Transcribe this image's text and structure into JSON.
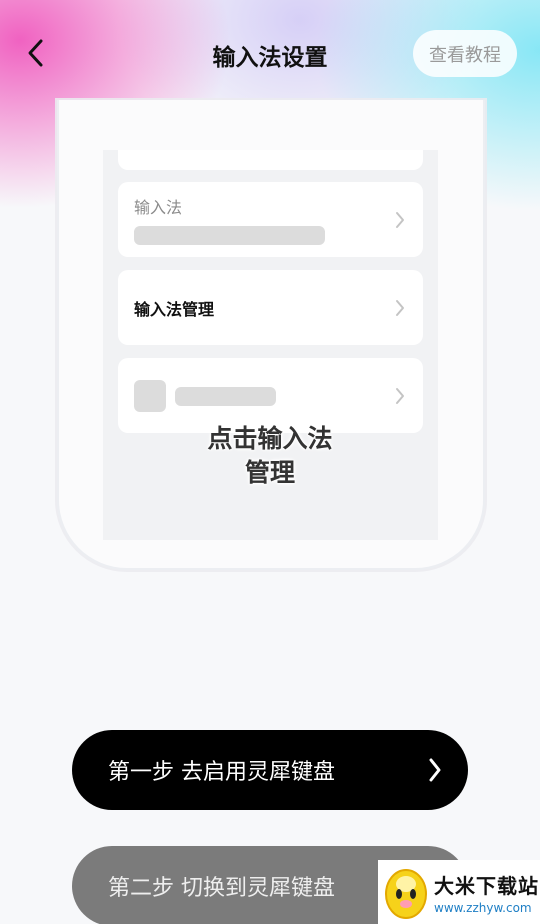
{
  "header": {
    "title": "输入法设置",
    "tutorial_label": "查看教程"
  },
  "preview": {
    "card_input_method_label": "输入法",
    "card_manage_label": "输入法管理",
    "hint_line1": "点击输入法",
    "hint_line2": "管理"
  },
  "steps": [
    {
      "label": "第一步 去启用灵犀键盘"
    },
    {
      "label": "第二步 切换到灵犀键盘"
    }
  ],
  "watermark": {
    "title": "大米下载站",
    "url": "www.zzhyw.com"
  },
  "colors": {
    "accent_pink": "#f05abe",
    "accent_cyan": "#82e6f5",
    "step1_bg": "#000000",
    "step2_bg": "#7b7b7b"
  },
  "icons": {
    "back": "chevron-left-icon",
    "row_arrow": "chevron-right-icon",
    "step_arrow": "chevron-right-icon",
    "logo": "egg-mascot-icon"
  }
}
